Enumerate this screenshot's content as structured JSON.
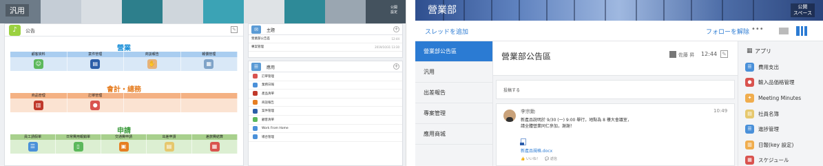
{
  "left": {
    "banner_title": "汎用",
    "banner_public": [
      "公開",
      "設定"
    ],
    "main_header": "公告",
    "sections": [
      {
        "title": "營業",
        "color": "#1a8fd8",
        "head_bg": "#a9cdf0",
        "body_bg": "#d9e8f7",
        "items": [
          {
            "label": "顧客資料",
            "icon": "contacts-icon",
            "color": "#5cb85c"
          },
          {
            "label": "案件管理",
            "icon": "notebook-icon",
            "color": "#2c5ea8"
          },
          {
            "label": "商談報告",
            "icon": "handshake-icon",
            "color": "#e6b27a"
          },
          {
            "label": "報價管理",
            "icon": "calculator-icon",
            "color": "#7fa3c8"
          }
        ]
      },
      {
        "title": "會計・總務",
        "color": "#e67e22",
        "head_bg": "#f4b183",
        "body_bg": "#fbe3d2",
        "items": [
          {
            "label": "商品管理",
            "icon": "box-icon",
            "color": "#c0392b"
          },
          {
            "label": "訂單管理",
            "icon": "piggybank-icon",
            "color": "#d9534f"
          },
          {
            "label": "",
            "icon": "",
            "color": ""
          },
          {
            "label": "",
            "icon": "",
            "color": ""
          }
        ]
      },
      {
        "title": "申請",
        "color": "#3a9a3a",
        "head_bg": "#a8d08d",
        "body_bg": "#dcefd2",
        "items": [
          {
            "label": "員工請假單",
            "icon": "list-icon",
            "color": "#4a90d9"
          },
          {
            "label": "日常費用報銷單",
            "icon": "receipt-icon",
            "color": "#5cb85c"
          },
          {
            "label": "交通費申請",
            "icon": "train-icon",
            "color": "#e67e22"
          },
          {
            "label": "出差申請",
            "icon": "document-icon",
            "color": "#e6c86e"
          },
          {
            "label": "差旅費結算",
            "icon": "calendar-icon",
            "color": "#d9534f"
          }
        ]
      }
    ],
    "threads_header": "主題",
    "threads": [
      {
        "title": "營業部公告區",
        "time": "12:44"
      },
      {
        "title": "專案管理",
        "time": "2019/10/31 13:30"
      }
    ],
    "apps_header": "應用",
    "apps": [
      {
        "name": "訂單管理",
        "color": "#d9534f"
      },
      {
        "name": "業務日報",
        "color": "#4a90d9"
      },
      {
        "name": "產品清單",
        "color": "#c0392b"
      },
      {
        "name": "商談報告",
        "color": "#e67e22"
      },
      {
        "name": "案件管理",
        "color": "#2c5ea8"
      },
      {
        "name": "顧客清單",
        "color": "#5cb85c"
      },
      {
        "name": "Work From Home",
        "color": "#4a90d9"
      },
      {
        "name": "場合管理",
        "color": "#4a90d9"
      }
    ]
  },
  "right": {
    "banner_title": "營業部",
    "banner_public": [
      "公開",
      "スペース"
    ],
    "add_thread": "スレッドを追加",
    "unfollow": "フォローを解除",
    "more": "•••",
    "nav": [
      "營業部公告區",
      "汎用",
      "出差報告",
      "專案管理",
      "應用商城"
    ],
    "post_title": "營業部公告區",
    "post_author": "佐藤 昇",
    "post_time": "12:44",
    "compose": "投稿する",
    "comment": {
      "author": "李宗勳",
      "time": "10:49",
      "lines": [
        "新產品說明於 9/30 (一) 9:00 舉行，地點為 8 樓大會議室，",
        "請全體營業同仁參加，謝謝！"
      ],
      "attachment": "新產品規格.docx",
      "like": "いいね！",
      "reply": "返信"
    },
    "apps_header": "アプリ",
    "apps": [
      {
        "name": "費用支出",
        "icon": "list-icon",
        "color": "#4a90d9"
      },
      {
        "name": "輸入品価格管理",
        "icon": "fire-icon",
        "color": "#d9534f"
      },
      {
        "name": "Meeting Minutes",
        "icon": "bulb-icon",
        "color": "#f0ad4e"
      },
      {
        "name": "社員名簿",
        "icon": "card-icon",
        "color": "#e6c86e"
      },
      {
        "name": "進捗管理",
        "icon": "list-icon",
        "color": "#4a90d9"
      },
      {
        "name": "日報(key 設定)",
        "icon": "book-icon",
        "color": "#f0ad4e"
      },
      {
        "name": "スケジュール",
        "icon": "calendar-icon",
        "color": "#d9534f"
      }
    ]
  }
}
